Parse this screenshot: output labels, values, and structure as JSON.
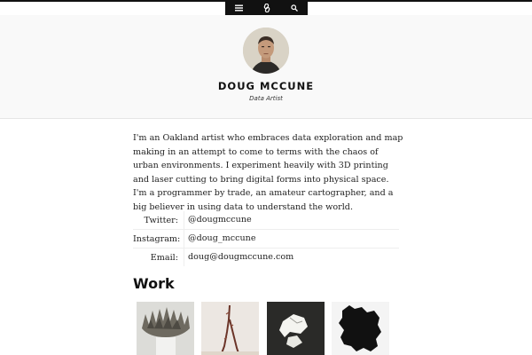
{
  "nav": {
    "menu_icon": "menu-icon",
    "link_icon": "link-icon",
    "search_icon": "search-icon"
  },
  "profile": {
    "name": "DOUG MCCUNE",
    "role": "Data Artist"
  },
  "bio": "I'm an Oakland artist who embraces data exploration and map making in an attempt to come to terms with the chaos of urban environments. I experiment heavily with 3D printing and laser cutting to bring digital forms into physical space. I'm a programmer by trade, an amateur cartographer, and a big believer in using data to understand the world.",
  "contacts": [
    {
      "label": "Twitter:",
      "value": "@dougmccune"
    },
    {
      "label": "Instagram:",
      "value": "@doug_mccune"
    },
    {
      "label": "Email:",
      "value": "doug@dougmccune.com"
    }
  ],
  "work": {
    "heading": "Work"
  },
  "colors": {
    "nav_background": "#111111",
    "header_background": "#f9f9f9"
  }
}
